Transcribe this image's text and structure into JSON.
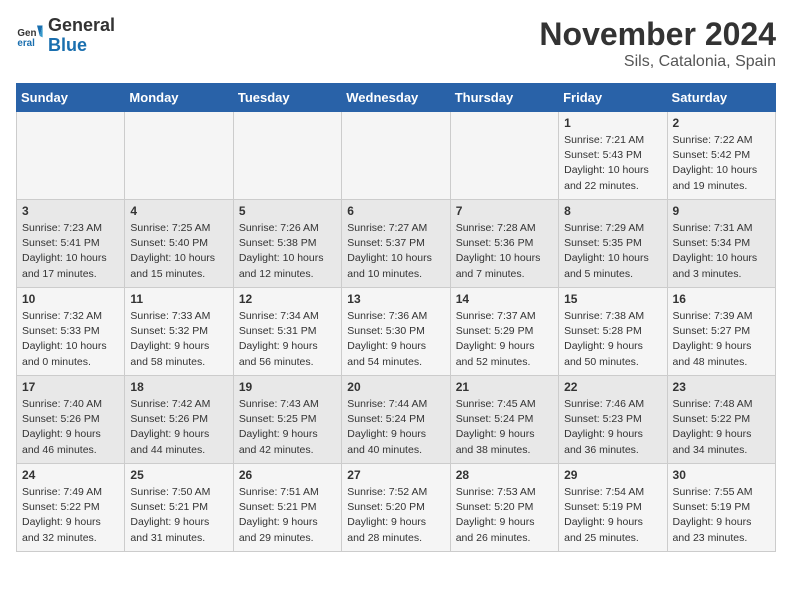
{
  "header": {
    "logo": {
      "general": "General",
      "blue": "Blue"
    },
    "title": "November 2024",
    "location": "Sils, Catalonia, Spain"
  },
  "weekdays": [
    "Sunday",
    "Monday",
    "Tuesday",
    "Wednesday",
    "Thursday",
    "Friday",
    "Saturday"
  ],
  "weeks": [
    [
      {
        "day": "",
        "info": ""
      },
      {
        "day": "",
        "info": ""
      },
      {
        "day": "",
        "info": ""
      },
      {
        "day": "",
        "info": ""
      },
      {
        "day": "",
        "info": ""
      },
      {
        "day": "1",
        "sunrise": "Sunrise: 7:21 AM",
        "sunset": "Sunset: 5:43 PM",
        "daylight": "Daylight: 10 hours and 22 minutes."
      },
      {
        "day": "2",
        "sunrise": "Sunrise: 7:22 AM",
        "sunset": "Sunset: 5:42 PM",
        "daylight": "Daylight: 10 hours and 19 minutes."
      }
    ],
    [
      {
        "day": "3",
        "sunrise": "Sunrise: 7:23 AM",
        "sunset": "Sunset: 5:41 PM",
        "daylight": "Daylight: 10 hours and 17 minutes."
      },
      {
        "day": "4",
        "sunrise": "Sunrise: 7:25 AM",
        "sunset": "Sunset: 5:40 PM",
        "daylight": "Daylight: 10 hours and 15 minutes."
      },
      {
        "day": "5",
        "sunrise": "Sunrise: 7:26 AM",
        "sunset": "Sunset: 5:38 PM",
        "daylight": "Daylight: 10 hours and 12 minutes."
      },
      {
        "day": "6",
        "sunrise": "Sunrise: 7:27 AM",
        "sunset": "Sunset: 5:37 PM",
        "daylight": "Daylight: 10 hours and 10 minutes."
      },
      {
        "day": "7",
        "sunrise": "Sunrise: 7:28 AM",
        "sunset": "Sunset: 5:36 PM",
        "daylight": "Daylight: 10 hours and 7 minutes."
      },
      {
        "day": "8",
        "sunrise": "Sunrise: 7:29 AM",
        "sunset": "Sunset: 5:35 PM",
        "daylight": "Daylight: 10 hours and 5 minutes."
      },
      {
        "day": "9",
        "sunrise": "Sunrise: 7:31 AM",
        "sunset": "Sunset: 5:34 PM",
        "daylight": "Daylight: 10 hours and 3 minutes."
      }
    ],
    [
      {
        "day": "10",
        "sunrise": "Sunrise: 7:32 AM",
        "sunset": "Sunset: 5:33 PM",
        "daylight": "Daylight: 10 hours and 0 minutes."
      },
      {
        "day": "11",
        "sunrise": "Sunrise: 7:33 AM",
        "sunset": "Sunset: 5:32 PM",
        "daylight": "Daylight: 9 hours and 58 minutes."
      },
      {
        "day": "12",
        "sunrise": "Sunrise: 7:34 AM",
        "sunset": "Sunset: 5:31 PM",
        "daylight": "Daylight: 9 hours and 56 minutes."
      },
      {
        "day": "13",
        "sunrise": "Sunrise: 7:36 AM",
        "sunset": "Sunset: 5:30 PM",
        "daylight": "Daylight: 9 hours and 54 minutes."
      },
      {
        "day": "14",
        "sunrise": "Sunrise: 7:37 AM",
        "sunset": "Sunset: 5:29 PM",
        "daylight": "Daylight: 9 hours and 52 minutes."
      },
      {
        "day": "15",
        "sunrise": "Sunrise: 7:38 AM",
        "sunset": "Sunset: 5:28 PM",
        "daylight": "Daylight: 9 hours and 50 minutes."
      },
      {
        "day": "16",
        "sunrise": "Sunrise: 7:39 AM",
        "sunset": "Sunset: 5:27 PM",
        "daylight": "Daylight: 9 hours and 48 minutes."
      }
    ],
    [
      {
        "day": "17",
        "sunrise": "Sunrise: 7:40 AM",
        "sunset": "Sunset: 5:26 PM",
        "daylight": "Daylight: 9 hours and 46 minutes."
      },
      {
        "day": "18",
        "sunrise": "Sunrise: 7:42 AM",
        "sunset": "Sunset: 5:26 PM",
        "daylight": "Daylight: 9 hours and 44 minutes."
      },
      {
        "day": "19",
        "sunrise": "Sunrise: 7:43 AM",
        "sunset": "Sunset: 5:25 PM",
        "daylight": "Daylight: 9 hours and 42 minutes."
      },
      {
        "day": "20",
        "sunrise": "Sunrise: 7:44 AM",
        "sunset": "Sunset: 5:24 PM",
        "daylight": "Daylight: 9 hours and 40 minutes."
      },
      {
        "day": "21",
        "sunrise": "Sunrise: 7:45 AM",
        "sunset": "Sunset: 5:24 PM",
        "daylight": "Daylight: 9 hours and 38 minutes."
      },
      {
        "day": "22",
        "sunrise": "Sunrise: 7:46 AM",
        "sunset": "Sunset: 5:23 PM",
        "daylight": "Daylight: 9 hours and 36 minutes."
      },
      {
        "day": "23",
        "sunrise": "Sunrise: 7:48 AM",
        "sunset": "Sunset: 5:22 PM",
        "daylight": "Daylight: 9 hours and 34 minutes."
      }
    ],
    [
      {
        "day": "24",
        "sunrise": "Sunrise: 7:49 AM",
        "sunset": "Sunset: 5:22 PM",
        "daylight": "Daylight: 9 hours and 32 minutes."
      },
      {
        "day": "25",
        "sunrise": "Sunrise: 7:50 AM",
        "sunset": "Sunset: 5:21 PM",
        "daylight": "Daylight: 9 hours and 31 minutes."
      },
      {
        "day": "26",
        "sunrise": "Sunrise: 7:51 AM",
        "sunset": "Sunset: 5:21 PM",
        "daylight": "Daylight: 9 hours and 29 minutes."
      },
      {
        "day": "27",
        "sunrise": "Sunrise: 7:52 AM",
        "sunset": "Sunset: 5:20 PM",
        "daylight": "Daylight: 9 hours and 28 minutes."
      },
      {
        "day": "28",
        "sunrise": "Sunrise: 7:53 AM",
        "sunset": "Sunset: 5:20 PM",
        "daylight": "Daylight: 9 hours and 26 minutes."
      },
      {
        "day": "29",
        "sunrise": "Sunrise: 7:54 AM",
        "sunset": "Sunset: 5:19 PM",
        "daylight": "Daylight: 9 hours and 25 minutes."
      },
      {
        "day": "30",
        "sunrise": "Sunrise: 7:55 AM",
        "sunset": "Sunset: 5:19 PM",
        "daylight": "Daylight: 9 hours and 23 minutes."
      }
    ]
  ]
}
